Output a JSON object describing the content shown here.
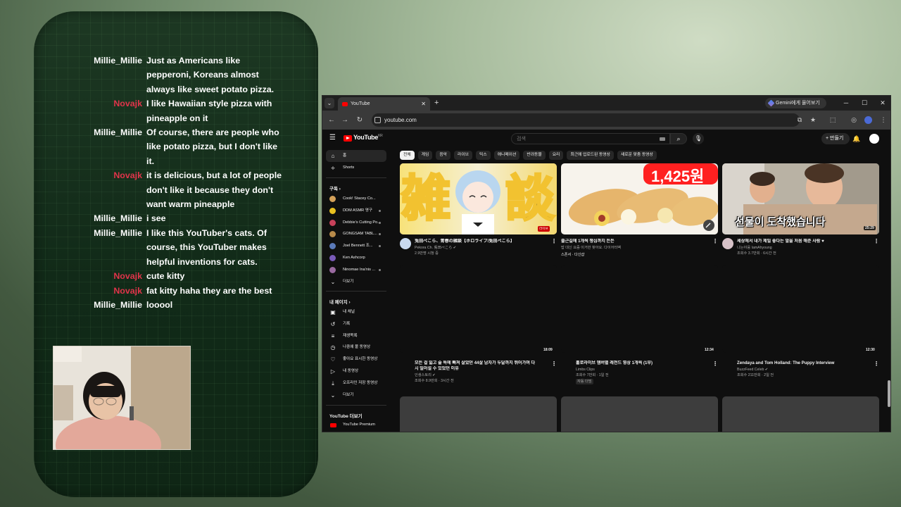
{
  "chat": {
    "messages": [
      {
        "user": "Millie_Millie",
        "text": "Just as Americans like pepperoni, Koreans almost always like sweet potato pizza."
      },
      {
        "user": "Novajk",
        "text": "I like Hawaiian style pizza with pineapple on it"
      },
      {
        "user": "Millie_Millie",
        "text": "Of course, there are people who like potato pizza, but I don't like it."
      },
      {
        "user": "Novajk",
        "text": "it is delicious, but a lot of people don't like it because they don't want warm pineapple"
      },
      {
        "user": "Millie_Millie",
        "text": "i see"
      },
      {
        "user": "Millie_Millie",
        "text": "I like this YouTuber's cats. Of course, this YouTuber makes helpful inventions for cats."
      },
      {
        "user": "Novajk",
        "text": "cute kitty"
      },
      {
        "user": "Novajk",
        "text": "fat kitty haha they are the best"
      },
      {
        "user": "Millie_Millie",
        "text": "looool"
      }
    ],
    "colors": {
      "millie": "#ffffff",
      "novajk": "#e0344a"
    }
  },
  "browser": {
    "tab_title": "YouTube",
    "tab_close": "✕",
    "new_tab": "+",
    "gemini_label": "Gemini에게 물어보기",
    "url": "youtube.com",
    "controls": {
      "minimize": "─",
      "maximize": "☐",
      "close": "✕"
    }
  },
  "youtube": {
    "logo_text": "YouTube",
    "logo_country": "KR",
    "search_placeholder": "검색",
    "create_label": "만들기",
    "chips": [
      "전체",
      "게임",
      "음악",
      "라이브",
      "믹스",
      "애니메이션",
      "반려동물",
      "요리",
      "최근에 업로드된 동영상",
      "새로운 맞춤 동영상"
    ],
    "sidebar": {
      "home": "홈",
      "shorts": "Shorts",
      "subscriptions_heading": "구독",
      "subscriptions": [
        {
          "name": "Cook! Stacey Co...",
          "color": "#d4a15a"
        },
        {
          "name": "DDM ASMR 영구",
          "color": "#e8c020"
        },
        {
          "name": "Debbie's Cutting Po...",
          "color": "#c8415a"
        },
        {
          "name": "GONGSAM TABL...",
          "color": "#b88a4a"
        },
        {
          "name": "Joel Bennett 조...",
          "color": "#5a79b8"
        },
        {
          "name": "Ken Ashcorp",
          "color": "#7a5ab8"
        },
        {
          "name": "Ninomae Ina'nis ...",
          "color": "#9a6aa0"
        }
      ],
      "more": "더보기",
      "my_page_heading": "내 페이지",
      "my_page_items": [
        {
          "icon": "▣",
          "label": "내 채널"
        },
        {
          "icon": "↺",
          "label": "기록"
        },
        {
          "icon": "≡",
          "label": "재생목록"
        },
        {
          "icon": "◷",
          "label": "나중에 볼 동영상"
        },
        {
          "icon": "♡",
          "label": "좋아요 표시한 동영상"
        },
        {
          "icon": "▷",
          "label": "내 동영상"
        },
        {
          "icon": "⤓",
          "label": "오프라인 저장 동영상"
        },
        {
          "icon": "⌄",
          "label": "더보기"
        }
      ],
      "explore_heading": "YouTube 더보기",
      "premium": "YouTube Premium"
    },
    "row1": [
      {
        "title": "兎田ぺこら、青春の雑談【ホロライブ/兎田ぺこら】",
        "channel": "Pekora Ch. 兎田ぺこら ✔",
        "meta": "2.9만명 시청 중",
        "badge": "라이브"
      },
      {
        "title": "출근길에 1개씩 챙심까지 든든",
        "channel": "밥 대신 요즘 이거만 찾아요. 다이어터벡",
        "meta": "스폰서 · 다신샵",
        "price": "1,425원"
      },
      {
        "title": "세상에서 내가 제일 좋다는 말을 처음 해준 사람 ♥",
        "channel": "나는야웅 IamAhyoung",
        "meta": "조회수 3.7만회 · 6시간 전",
        "duration": "25:29",
        "overlay": "선물이 도착했습니다"
      }
    ],
    "row2": [
      {
        "title_line1": "모든 걸 잃고 술 독에 빠져 살았던 44살 남자가 두달까지 뛰어가며 다",
        "title_line2": "시 일어설 수 있었던 이유",
        "channel": "인생스토리 ✔",
        "meta": "조회수 8.9만회 · 3시간 전",
        "duration": "18:09"
      },
      {
        "title_line1": "홀로라이브 멤버별 레전드 영상 1개씩 (1부)",
        "channel": "Limbs Clips",
        "meta": "조회수 7만회 · 1일 전",
        "badge": "자동 더빙",
        "duration": "12:34"
      },
      {
        "title_line1": "Zendaya and Tom Holland: The Puppy Interview",
        "channel": "BuzzFeed Celeb ✔",
        "meta": "조회수 211만회 · 2일 전",
        "duration": "12:30"
      }
    ]
  }
}
